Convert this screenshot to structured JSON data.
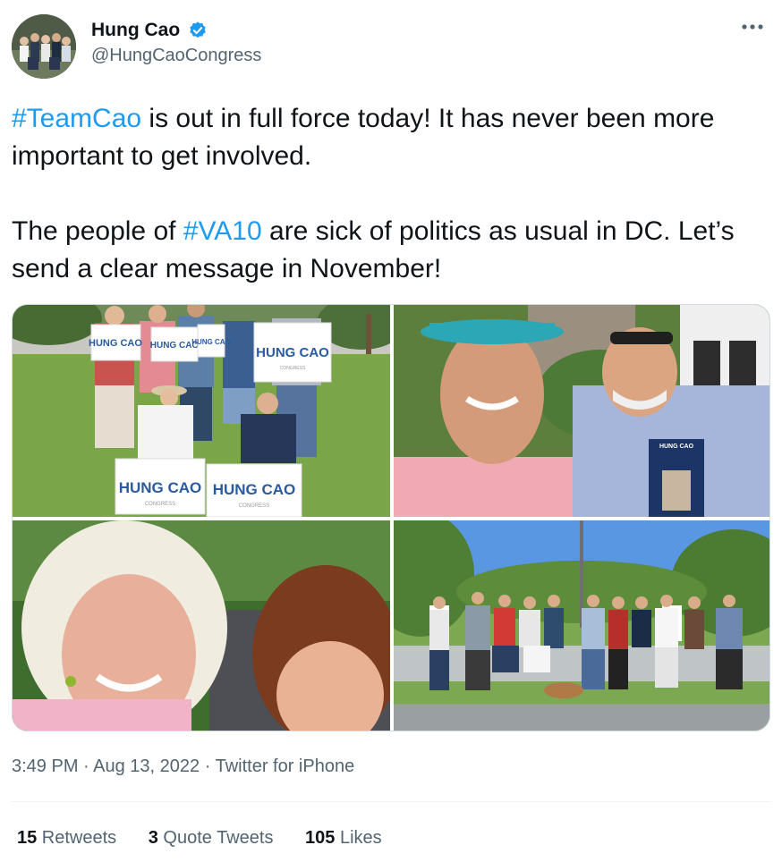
{
  "author": {
    "display_name": "Hung Cao",
    "handle": "@HungCaoCongress",
    "verified_icon": "verified-badge-icon",
    "more_icon": "more-options-icon"
  },
  "tweet": {
    "p1_hashtag": "#TeamCao",
    "p1_text": " is out in full force today! It has never been more important to get involved.",
    "p2_text_a": "The people of ",
    "p2_hashtag": "#VA10",
    "p2_text_b": " are sick of politics as usual in DC. Let’s send a clear message in November!"
  },
  "photos": {
    "signs": [
      "HUNG CAO",
      "HUNG CAO",
      "HUNG CAO",
      "HUNG CAO",
      "HUNG CAO",
      "HUNG CAO"
    ],
    "sign_sub": "CONGRESS",
    "flyer_title": "HUNG CAO"
  },
  "meta": {
    "time": "3:49 PM",
    "sep1": " · ",
    "date": "Aug 13, 2022",
    "sep2": " · ",
    "source": "Twitter for iPhone"
  },
  "stats": {
    "retweets_count": "15",
    "retweets_label": " Retweets",
    "quotes_count": "3",
    "quotes_label": " Quote Tweets",
    "likes_count": "105",
    "likes_label": " Likes"
  },
  "colors": {
    "accent": "#1d9bf0",
    "text": "#0f1419",
    "secondary": "#536471"
  }
}
